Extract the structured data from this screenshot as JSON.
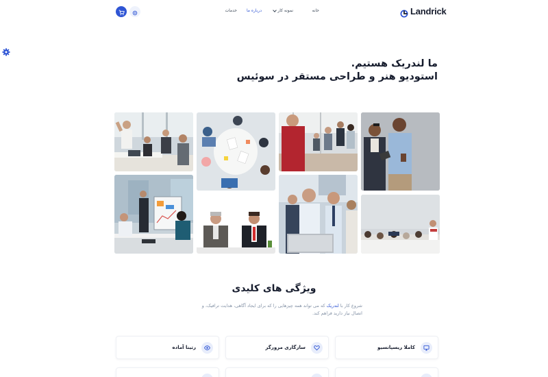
{
  "brand": {
    "name": "Landrick",
    "accent": "#2f55d4"
  },
  "nav": {
    "home": "خانه",
    "portfolio": "نمونه کار",
    "about": "درباره ما",
    "services": "خدمات"
  },
  "icons": {
    "cart": "cart-icon",
    "settings": "settings-icon",
    "side": "gear-icon"
  },
  "hero": {
    "line1": "ما لندریک هستیم.",
    "line2": "استودیو هنر و طراحی مستقر در سوئیس"
  },
  "gallery": [
    {
      "name": "office-team-celebrating"
    },
    {
      "name": "top-view-meeting-table"
    },
    {
      "name": "presenter-red-sweater"
    },
    {
      "name": "two-colleagues-with-tablet"
    },
    {
      "name": "whiteboard-presentation"
    },
    {
      "name": "two-men-discussion"
    },
    {
      "name": "business-team-laptop"
    },
    {
      "name": "tired-team-meeting"
    }
  ],
  "features": {
    "title": "ویژگی های کلیدی",
    "desc_before": "شروع کار با ",
    "desc_brand": "لندریک",
    "desc_after": " که می تواند همه چیزهایی را که برای ایجاد آگاهی، هدایت ترافیک، و اتصال نیاز دارید فراهم کند.",
    "cards": [
      {
        "label": "کاملا ریسپانسیو",
        "icon": "monitor-icon"
      },
      {
        "label": "سازگاری مرورگر",
        "icon": "heart-icon"
      },
      {
        "label": "رتینا آماده",
        "icon": "eye-icon"
      }
    ]
  }
}
